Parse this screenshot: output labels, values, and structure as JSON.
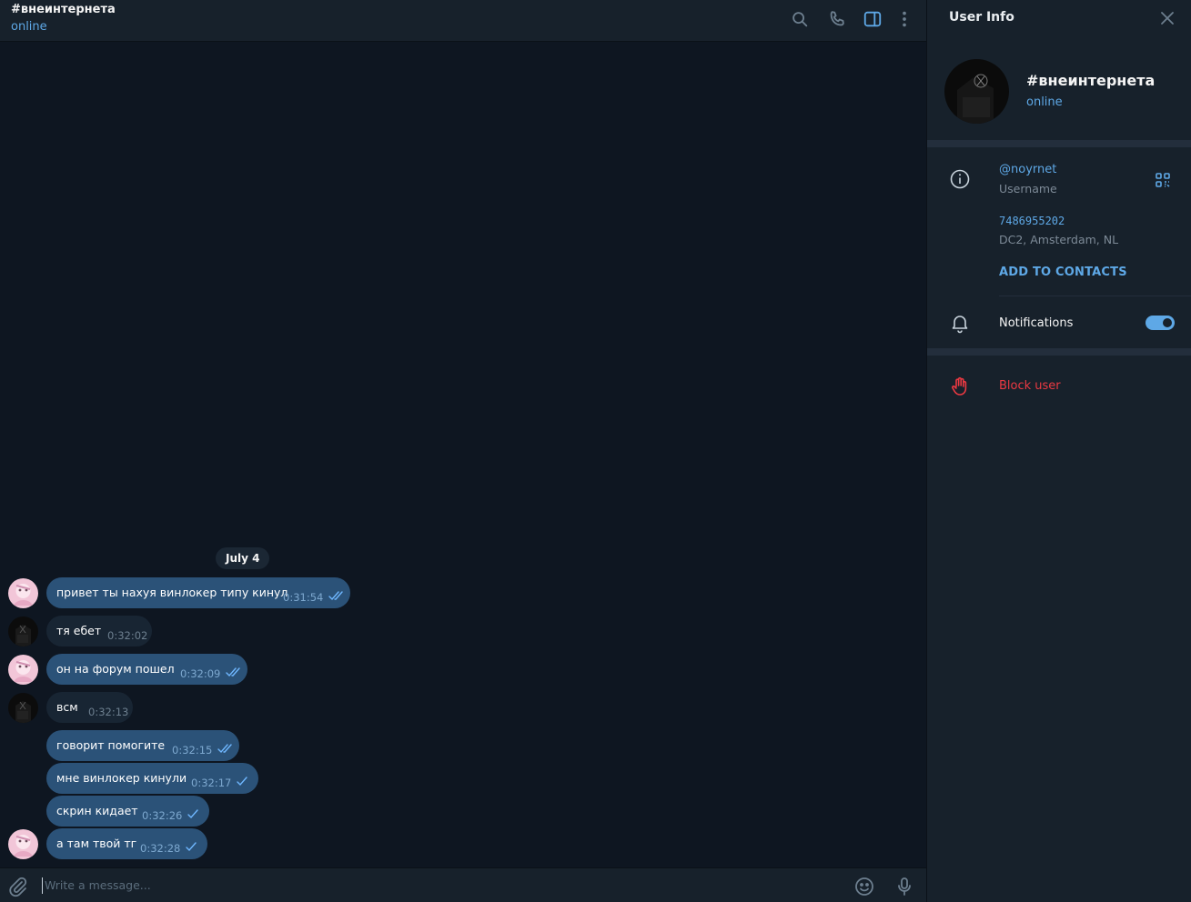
{
  "header": {
    "title": "#внеинтернета",
    "status": "online"
  },
  "icons": {
    "search": "search-icon",
    "call": "phone-icon",
    "side_panel": "side-panel-icon",
    "more": "more-vertical-icon",
    "attach": "paperclip-icon",
    "emoji": "emoji-icon",
    "mic": "microphone-icon"
  },
  "colors": {
    "accent": "#5ea8e6",
    "outgoing_bubble": "#2b5278",
    "incoming_bubble": "#182533",
    "danger": "#ec3942",
    "background": "#0e1621",
    "panel": "#17212b"
  },
  "chat": {
    "date_label": "July 4",
    "messages": [
      {
        "text": "привет ты нахуя винлокер типу кинул",
        "time": "0:31:54",
        "direction": "out",
        "status": "read"
      },
      {
        "text": "тя ебет",
        "time": "0:32:02",
        "direction": "in"
      },
      {
        "text": "он на форум пошел",
        "time": "0:32:09",
        "direction": "out",
        "status": "read"
      },
      {
        "text": "всм",
        "time": "0:32:13",
        "direction": "in"
      },
      {
        "text": "говорит помогите",
        "time": "0:32:15",
        "direction": "out",
        "status": "read"
      },
      {
        "text": "мне винлокер кинули",
        "time": "0:32:17",
        "direction": "out",
        "status": "sent"
      },
      {
        "text": "скрин кидает",
        "time": "0:32:26",
        "direction": "out",
        "status": "sent"
      },
      {
        "text": "а там твой тг",
        "time": "0:32:28",
        "direction": "out",
        "status": "sent"
      }
    ]
  },
  "composer": {
    "placeholder": "Write a message..."
  },
  "panel": {
    "title": "User Info",
    "name": "#внеинтернета",
    "status": "online",
    "username": "@noyrnet",
    "username_label": "Username",
    "user_id": "7486955202",
    "dc_label": "DC2, Amsterdam, NL",
    "add_contacts": "ADD TO CONTACTS",
    "notifications_label": "Notifications",
    "notifications_on": true,
    "block_label": "Block user"
  }
}
